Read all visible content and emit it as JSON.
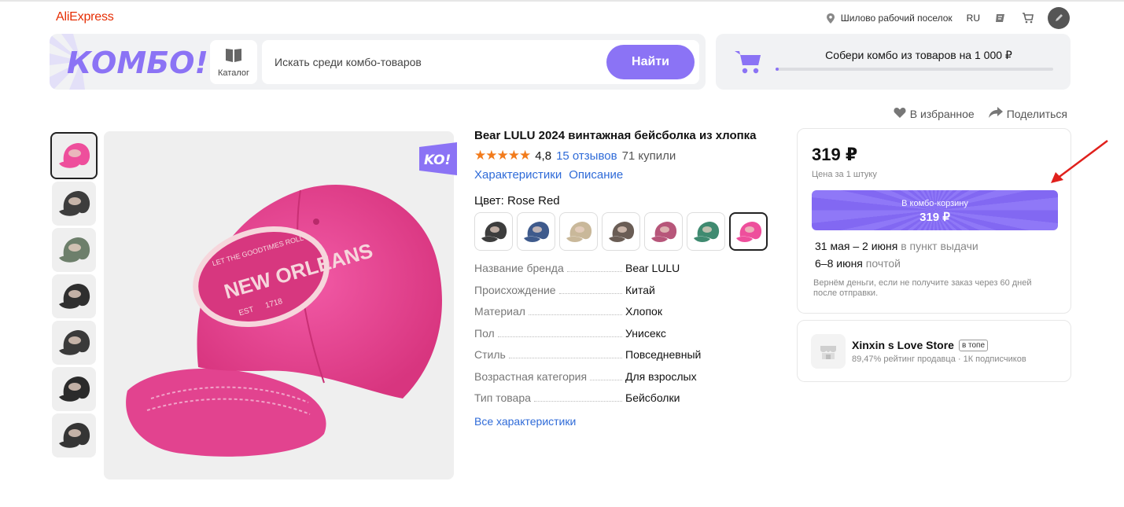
{
  "header": {
    "logo": "AliExpress",
    "location": "Шилово рабочий поселок",
    "language": "RU"
  },
  "combo": {
    "logo_text": "КОМБО!",
    "catalog_label": "Каталог",
    "search_placeholder": "Искать среди комбо-товаров",
    "search_button": "Найти",
    "goal_text": "Собери комбо из товаров на 1 000 ₽",
    "goal_progress": 0.01
  },
  "actions": {
    "favorite": "В избранное",
    "share": "Поделиться"
  },
  "product": {
    "badge": "KO!",
    "title": "Bear LULU 2024 винтажная бейсболка из хлопка",
    "stars": "★★★★★",
    "rating": "4,8",
    "reviews": "15 отзывов",
    "bought": "71 купили",
    "tab_specs": "Характеристики",
    "tab_description": "Описание",
    "color_label": "Цвет: Rose Red",
    "swatch_colors": [
      "#3d3d3d",
      "#3e5a8c",
      "#c9b89a",
      "#6a5d55",
      "#b7567a",
      "#3f8a70",
      "#ee4f9c"
    ],
    "active_swatch": 6,
    "cap_text": "NEW ORLEANS",
    "cap_subtext": "LET THE GOODTIMES ROLL",
    "cap_est": "EST",
    "cap_year": "1718",
    "specs": [
      {
        "k": "Название бренда",
        "v": "Bear LULU"
      },
      {
        "k": "Происхождение",
        "v": "Китай"
      },
      {
        "k": "Материал",
        "v": "Хлопок"
      },
      {
        "k": "Пол",
        "v": "Унисекс"
      },
      {
        "k": "Стиль",
        "v": "Повседневный"
      },
      {
        "k": "Возрастная категория",
        "v": "Для взрослых"
      },
      {
        "k": "Тип товара",
        "v": "Бейсболки"
      }
    ],
    "all_specs": "Все характеристики",
    "thumb_colors": [
      "#ee4f9c",
      "#3d3d3d",
      "#6d7f6b",
      "#2f2f2f",
      "#3a3a3a",
      "#2b2b2b",
      "#353535"
    ]
  },
  "buy": {
    "price": "319 ₽",
    "price_note": "Цена за 1 штуку",
    "cart_line1": "В комбо-корзину",
    "cart_line2": "319 ₽",
    "delivery1_date": "31 мая – 2 июня",
    "delivery1_mode": "в пункт выдачи",
    "delivery2_date": "6–8 июня",
    "delivery2_mode": "почтой",
    "refund": "Вернём деньги, если не получите заказ через 60 дней после отправки."
  },
  "seller": {
    "name": "Xinxin s Love Store",
    "badge": "в топе",
    "meta": "89,47% рейтинг продавца · 1К подписчиков"
  },
  "colors": {
    "accent": "#8b73f5",
    "brand": "#e62e04",
    "star": "#f27b1b",
    "link": "#2f6bd8",
    "arrow": "#e0201c"
  }
}
